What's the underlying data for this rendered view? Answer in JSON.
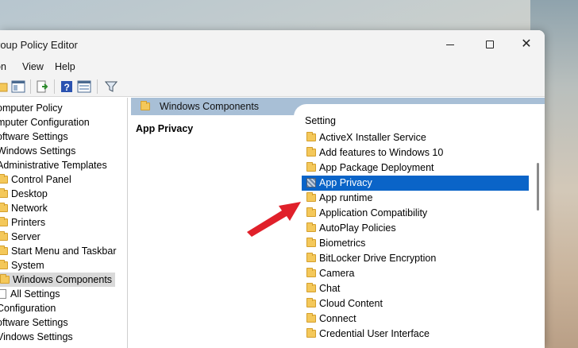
{
  "window": {
    "title": "Group Policy Editor",
    "title_visible": "roup Policy Editor",
    "controls": {
      "minimize": "minimize",
      "maximize": "maximize",
      "close": "close"
    }
  },
  "menu": {
    "action": "on",
    "view": "View",
    "help": "Help"
  },
  "toolbar": [
    "back-icon",
    "forward-icon",
    "up-folder-icon",
    "show-hide-tree-icon",
    "export-list-icon",
    "help-icon",
    "properties-icon",
    "filter-icon"
  ],
  "tree": [
    {
      "label": "omputer Policy",
      "indent": 0
    },
    {
      "label": "mputer Configuration",
      "indent": 0
    },
    {
      "label": "oftware Settings",
      "indent": 0
    },
    {
      "label": "Windows Settings",
      "indent": 0
    },
    {
      "label": "Administrative Templates",
      "indent": 0
    },
    {
      "label": "Control Panel",
      "indent": 1,
      "folder": true
    },
    {
      "label": "Desktop",
      "indent": 1,
      "folder": true
    },
    {
      "label": "Network",
      "indent": 1,
      "folder": true
    },
    {
      "label": "Printers",
      "indent": 1,
      "folder": true
    },
    {
      "label": "Server",
      "indent": 1,
      "folder": true
    },
    {
      "label": "Start Menu and Taskbar",
      "indent": 1,
      "folder": true
    },
    {
      "label": "System",
      "indent": 1,
      "folder": true
    },
    {
      "label": "Windows Components",
      "indent": 1,
      "folder": true,
      "selected": true
    },
    {
      "label": "All Settings",
      "indent": 1,
      "doc": true
    },
    {
      "label": "Configuration",
      "indent": 0
    },
    {
      "label": "oftware Settings",
      "indent": 0
    },
    {
      "label": "Vindows Settings",
      "indent": 0
    }
  ],
  "right": {
    "header": "Windows Components",
    "extended_title": "App Privacy",
    "column_header": "Setting",
    "settings": [
      {
        "label": "ActiveX Installer Service"
      },
      {
        "label": "Add features to Windows 10"
      },
      {
        "label": "App Package Deployment"
      },
      {
        "label": "App Privacy",
        "selected": true
      },
      {
        "label": "App runtime"
      },
      {
        "label": "Application Compatibility"
      },
      {
        "label": "AutoPlay Policies"
      },
      {
        "label": "Biometrics"
      },
      {
        "label": "BitLocker Drive Encryption"
      },
      {
        "label": "Camera"
      },
      {
        "label": "Chat"
      },
      {
        "label": "Cloud Content"
      },
      {
        "label": "Connect"
      },
      {
        "label": "Credential User Interface"
      }
    ]
  },
  "colors": {
    "selection": "#0a64c8",
    "header_bar": "#a8bfd6",
    "folder": "#f4c85a",
    "arrow": "#e0202a"
  }
}
